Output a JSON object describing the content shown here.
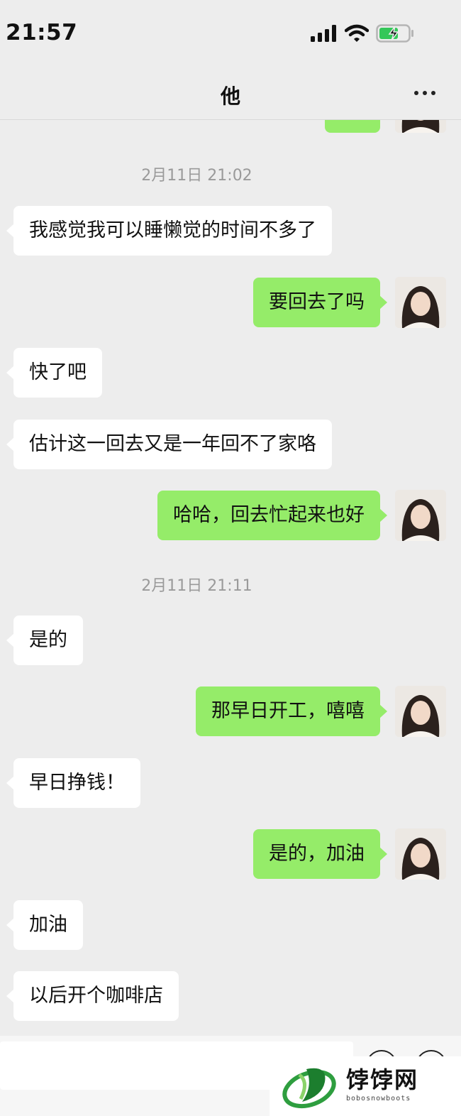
{
  "status_bar": {
    "time": "21:57"
  },
  "header": {
    "title": "他"
  },
  "messages": [
    {
      "type": "timestamp",
      "text": "2月11日 21:02"
    },
    {
      "type": "in",
      "text": "我感觉我可以睡懒觉的时间不多了"
    },
    {
      "type": "out",
      "text": "要回去了吗"
    },
    {
      "type": "in",
      "text": "快了吧"
    },
    {
      "type": "in",
      "text": "估计这一回去又是一年回不了家咯"
    },
    {
      "type": "out",
      "text": "哈哈，回去忙起来也好"
    },
    {
      "type": "timestamp",
      "text": "2月11日 21:11"
    },
    {
      "type": "in",
      "text": "是的"
    },
    {
      "type": "out",
      "text": "那早日开工，嘻嘻"
    },
    {
      "type": "in",
      "text": "早日挣钱！"
    },
    {
      "type": "out",
      "text": "是的，加油"
    },
    {
      "type": "in",
      "text": "加油"
    },
    {
      "type": "in",
      "text": "以后开个咖啡店"
    }
  ],
  "watermark": {
    "text": "饽饽网",
    "sub": "bobosnowboots"
  },
  "colors": {
    "background": "#ededed",
    "outgoing_bubble": "#95ec69",
    "incoming_bubble": "#ffffff",
    "battery": "#34c759"
  }
}
